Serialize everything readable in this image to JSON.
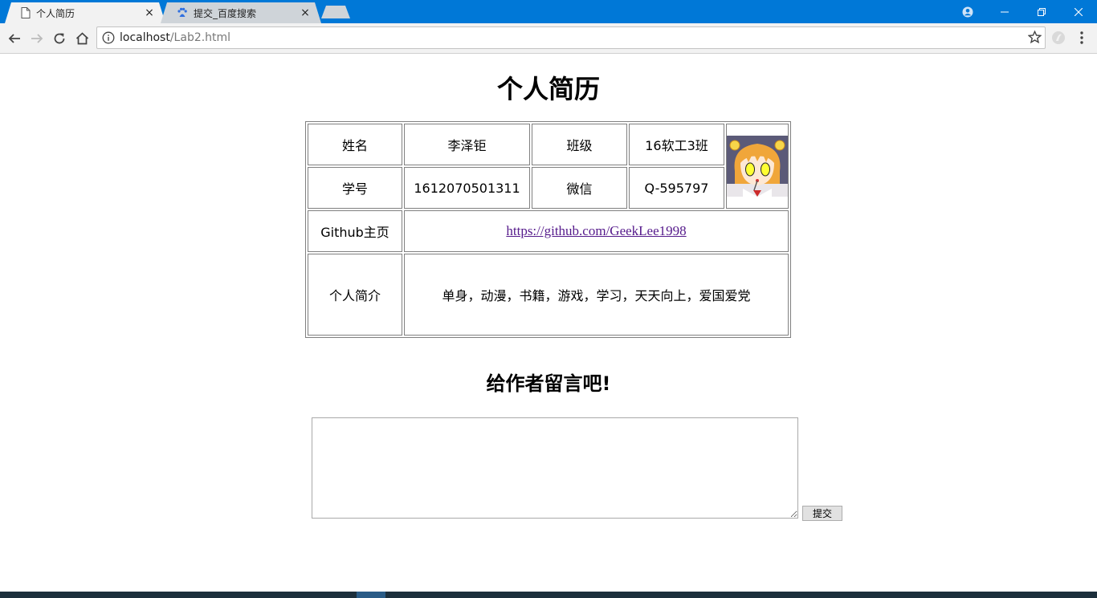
{
  "browser": {
    "tabs": [
      {
        "title": "个人简历",
        "icon": "page-icon",
        "active": true
      },
      {
        "title": "提交_百度搜索",
        "icon": "baidu-paw-icon",
        "active": false
      }
    ],
    "tab_close_glyph": "×",
    "url_host": "localhost",
    "url_path": "/Lab2.html"
  },
  "page": {
    "title": "个人简历",
    "table": {
      "name_label": "姓名",
      "name_value": "李泽钜",
      "class_label": "班级",
      "class_value": "16软工3班",
      "id_label": "学号",
      "id_value": "1612070501311",
      "wechat_label": "微信",
      "wechat_value": "Q-595797",
      "github_label": "Github主页",
      "github_url": "https://github.com/GeekLee1998",
      "intro_label": "个人简介",
      "intro_value": "单身，动漫，书籍，游戏，学习，天天向上，爱国爱党"
    },
    "message_title": "给作者留言吧!",
    "message_text": "",
    "submit_label": "提交"
  },
  "colors": {
    "titlebar": "#0078d7",
    "link_visited": "#551a8b"
  }
}
